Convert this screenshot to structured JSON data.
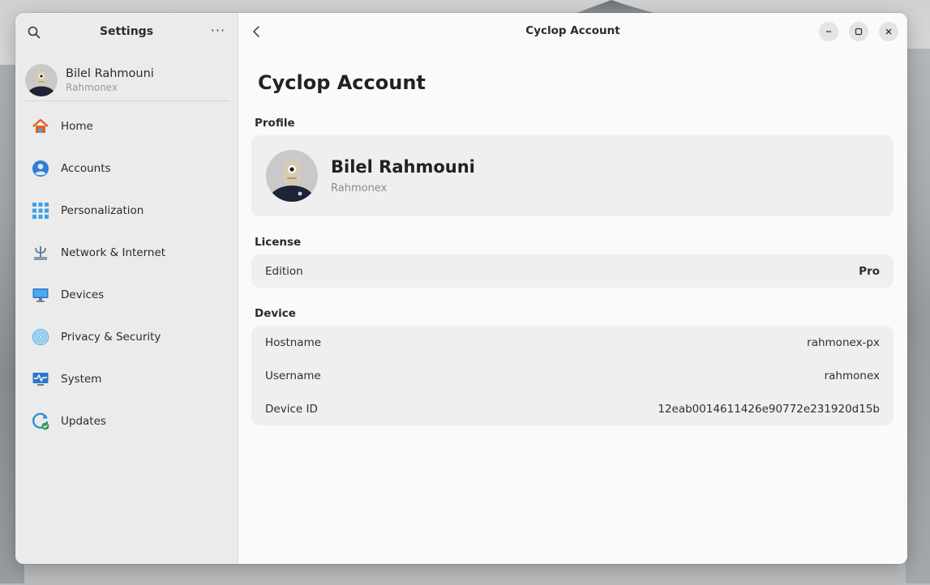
{
  "sidebar": {
    "title": "Settings",
    "more_glyph": "···",
    "user": {
      "name": "Bilel Rahmouni",
      "username": "Rahmonex"
    },
    "items": [
      {
        "label": "Home",
        "icon": "home-icon"
      },
      {
        "label": "Accounts",
        "icon": "accounts-icon"
      },
      {
        "label": "Personalization",
        "icon": "personalization-icon"
      },
      {
        "label": "Network & Internet",
        "icon": "network-icon"
      },
      {
        "label": "Devices",
        "icon": "devices-icon"
      },
      {
        "label": "Privacy & Security",
        "icon": "fingerprint-icon"
      },
      {
        "label": "System",
        "icon": "system-icon"
      },
      {
        "label": "Updates",
        "icon": "updates-icon"
      }
    ]
  },
  "header": {
    "title": "Cyclop Account"
  },
  "main": {
    "page_title": "Cyclop Account",
    "profile": {
      "section": "Profile",
      "name": "Bilel Rahmouni",
      "username": "Rahmonex"
    },
    "license": {
      "section": "License",
      "rows": [
        {
          "key": "Edition",
          "value": "Pro"
        }
      ]
    },
    "device": {
      "section": "Device",
      "rows": [
        {
          "key": "Hostname",
          "value": "rahmonex-px"
        },
        {
          "key": "Username",
          "value": "rahmonex"
        },
        {
          "key": "Device ID",
          "value": "12eab0014611426e90772e231920d15b"
        }
      ]
    }
  },
  "colors": {
    "accent_blue": "#2e7ed6",
    "home_orange": "#e0612a",
    "updates_green": "#2e9e4f"
  }
}
